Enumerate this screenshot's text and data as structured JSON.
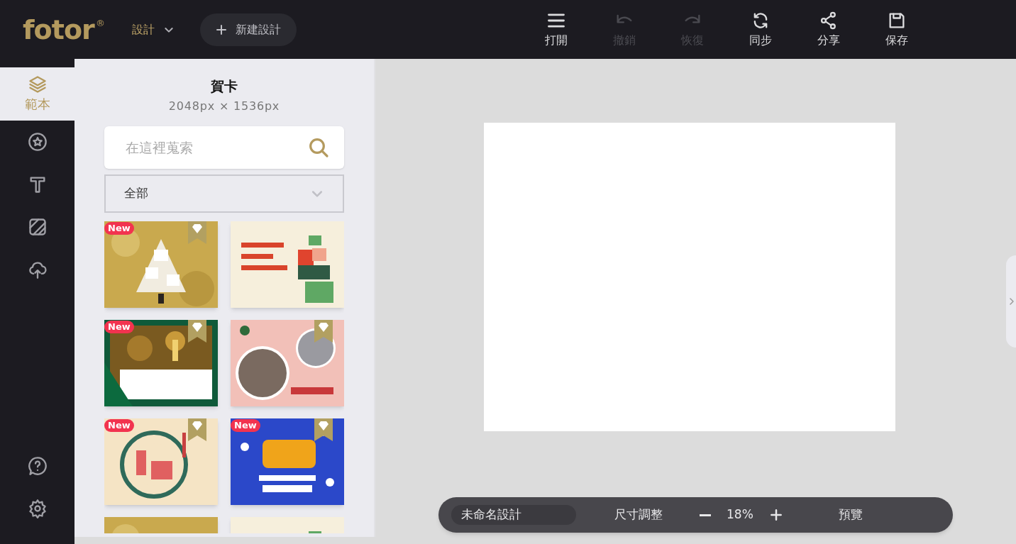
{
  "header": {
    "logo": "fotor",
    "logo_mark": "®",
    "design_menu": "設計",
    "new_design": "新建設計",
    "tools": [
      {
        "label": "打開",
        "disabled": false
      },
      {
        "label": "撤銷",
        "disabled": true
      },
      {
        "label": "恢復",
        "disabled": true
      },
      {
        "label": "同步",
        "disabled": false
      },
      {
        "label": "分享",
        "disabled": false
      },
      {
        "label": "保存",
        "disabled": false
      }
    ]
  },
  "sidebar": {
    "items": [
      {
        "label": "範本",
        "selected": true
      },
      {
        "selected": false
      },
      {
        "selected": false
      },
      {
        "selected": false
      },
      {
        "selected": false
      }
    ],
    "bottom_items": [
      {
        "kind": "help"
      },
      {
        "kind": "settings"
      }
    ]
  },
  "panel": {
    "title": "賀卡",
    "size": "2048px × 1536px",
    "search": {
      "placeholder": "在這裡蒐索"
    },
    "filter": "全部",
    "templates": [
      {
        "kind": "picture",
        "badge": "New",
        "premium": true
      },
      {
        "kind": "picture",
        "premium": false
      },
      {
        "kind": "picture",
        "badge": "New",
        "premium": true
      },
      {
        "kind": "picture",
        "premium": true
      },
      {
        "kind": "picture",
        "badge": "New",
        "premium": true
      },
      {
        "kind": "picture",
        "badge": "New",
        "premium": true
      },
      {
        "kind": "picture"
      },
      {
        "kind": "picture"
      }
    ]
  },
  "bottom_bar": {
    "design_name": "未命名設計",
    "resize": "尺寸調整",
    "zoom": "18%",
    "preview": "預覽"
  }
}
